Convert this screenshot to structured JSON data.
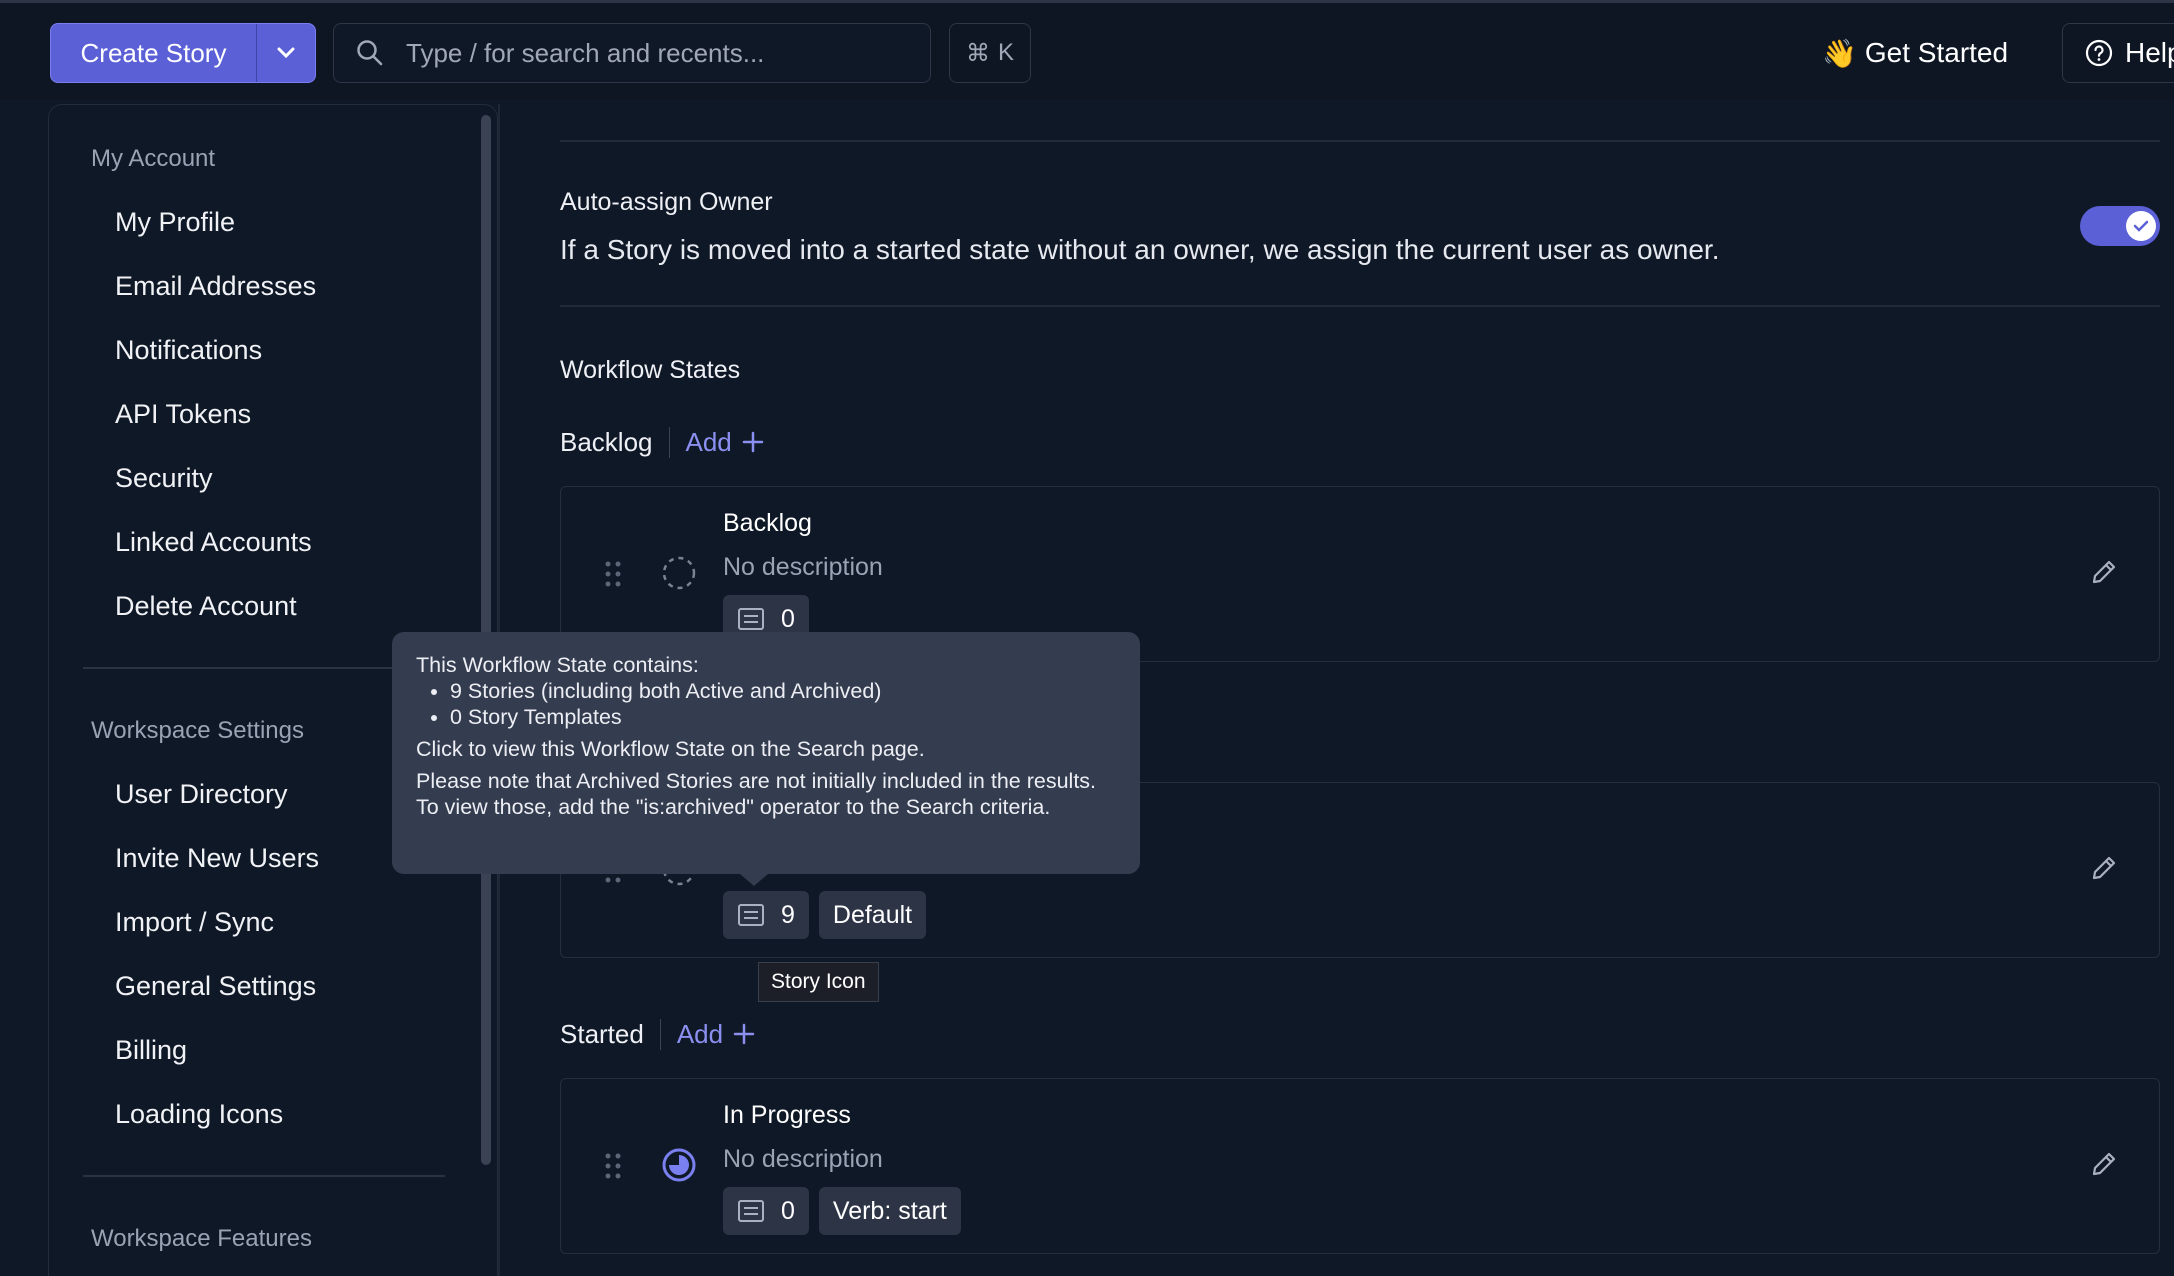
{
  "topbar": {
    "create_label": "Create Story",
    "search_placeholder": "Type / for search and recents...",
    "shortcut_symbol": "⌘",
    "shortcut_key": "K",
    "get_started_emoji": "👋",
    "get_started_label": "Get Started",
    "help_label": "Help"
  },
  "sidebar": {
    "my_account_title": "My Account",
    "my_account_items": [
      "My Profile",
      "Email Addresses",
      "Notifications",
      "API Tokens",
      "Security",
      "Linked Accounts",
      "Delete Account"
    ],
    "workspace_settings_title": "Workspace Settings",
    "workspace_settings_items": [
      "User Directory",
      "Invite New Users",
      "Import / Sync",
      "General Settings",
      "Billing",
      "Loading Icons"
    ],
    "workspace_features_title": "Workspace Features"
  },
  "main": {
    "auto_assign_title": "Auto-assign Owner",
    "auto_assign_desc": "If a Story is moved into a started state without an owner, we assign the current user as owner.",
    "auto_assign_enabled": true,
    "workflow_states_title": "Workflow States",
    "add_label": "Add",
    "groups": [
      {
        "name": "Backlog"
      },
      {
        "name": "Started"
      }
    ],
    "cards": [
      {
        "title": "Backlog",
        "desc": "No description",
        "count": "0"
      },
      {
        "count": "9",
        "badge": "Default"
      },
      {
        "title": "In Progress",
        "desc": "No description",
        "count": "0",
        "badge": "Verb: start"
      }
    ]
  },
  "tooltip": {
    "intro": "This Workflow State contains:",
    "items": [
      "9 Stories (including both Active and Archived)",
      "0 Story Templates"
    ],
    "line2": "Click to view this Workflow State on the Search page.",
    "line3": "Please note that Archived Stories are not initially included in the results. To view those, add the \"is:archived\" operator to the Search criteria."
  },
  "small_tip": "Story Icon",
  "colors": {
    "accent": "#5b60d6",
    "link": "#8b8ff0",
    "background": "#0f1826"
  }
}
